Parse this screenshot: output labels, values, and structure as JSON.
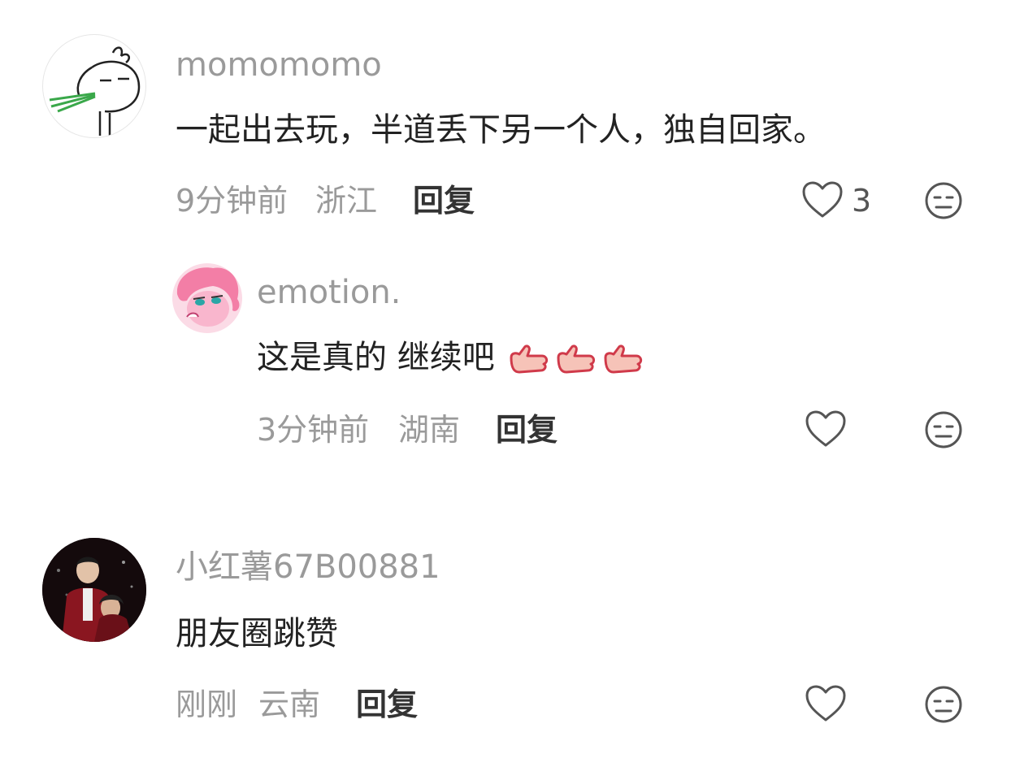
{
  "comments": [
    {
      "username": "momomomo",
      "content": "一起出去玩，半道丢下另一个人，独自回家。",
      "time": "9分钟前",
      "location": "浙江",
      "reply_label": "回复",
      "likes": "3",
      "avatar_icon": "bunny-sketch-avatar"
    },
    {
      "username": "emotion.",
      "content": "这是真的 继续吧",
      "time": "3分钟前",
      "location": "湖南",
      "reply_label": "回复",
      "likes": "",
      "avatar_icon": "pink-pony-avatar",
      "emoji_icon": "thumbs-up-icon"
    },
    {
      "username": "小红薯67B00881",
      "content": "朋友圈跳赞",
      "time": "刚刚",
      "location": "云南",
      "reply_label": "回复",
      "likes": "",
      "avatar_icon": "couple-photo-avatar"
    }
  ],
  "colors": {
    "meta_gray": "#9a9a9a",
    "text_dark": "#222222",
    "icon_gray": "#555555"
  }
}
